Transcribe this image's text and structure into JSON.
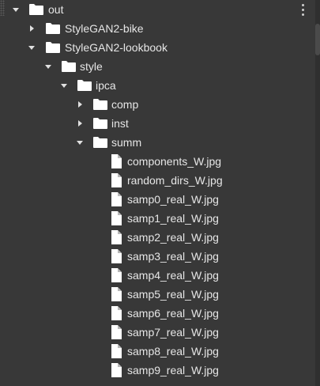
{
  "tree": {
    "root": {
      "label": "out",
      "icon": "folder-icon",
      "expanded": true
    },
    "nodes": [
      {
        "label": "StyleGAN2-bike",
        "icon": "folder-icon",
        "type": "folder",
        "expanded": false
      },
      {
        "label": "StyleGAN2-lookbook",
        "icon": "folder-icon",
        "type": "folder",
        "expanded": true
      },
      {
        "label": "style",
        "icon": "folder-icon",
        "type": "folder",
        "expanded": true
      },
      {
        "label": "ipca",
        "icon": "folder-icon",
        "type": "folder",
        "expanded": true
      },
      {
        "label": "comp",
        "icon": "folder-icon",
        "type": "folder",
        "expanded": false
      },
      {
        "label": "inst",
        "icon": "folder-icon",
        "type": "folder",
        "expanded": false
      },
      {
        "label": "summ",
        "icon": "folder-icon",
        "type": "folder",
        "expanded": true
      },
      {
        "label": "components_W.jpg",
        "icon": "file-icon",
        "type": "file"
      },
      {
        "label": "random_dirs_W.jpg",
        "icon": "file-icon",
        "type": "file"
      },
      {
        "label": "samp0_real_W.jpg",
        "icon": "file-icon",
        "type": "file"
      },
      {
        "label": "samp1_real_W.jpg",
        "icon": "file-icon",
        "type": "file"
      },
      {
        "label": "samp2_real_W.jpg",
        "icon": "file-icon",
        "type": "file"
      },
      {
        "label": "samp3_real_W.jpg",
        "icon": "file-icon",
        "type": "file"
      },
      {
        "label": "samp4_real_W.jpg",
        "icon": "file-icon",
        "type": "file"
      },
      {
        "label": "samp5_real_W.jpg",
        "icon": "file-icon",
        "type": "file"
      },
      {
        "label": "samp6_real_W.jpg",
        "icon": "file-icon",
        "type": "file"
      },
      {
        "label": "samp7_real_W.jpg",
        "icon": "file-icon",
        "type": "file"
      },
      {
        "label": "samp8_real_W.jpg",
        "icon": "file-icon",
        "type": "file"
      },
      {
        "label": "samp9_real_W.jpg",
        "icon": "file-icon",
        "type": "file"
      }
    ]
  },
  "colors": {
    "background": "#383838",
    "text": "#e6e6e6",
    "icon": "#ffffff"
  }
}
